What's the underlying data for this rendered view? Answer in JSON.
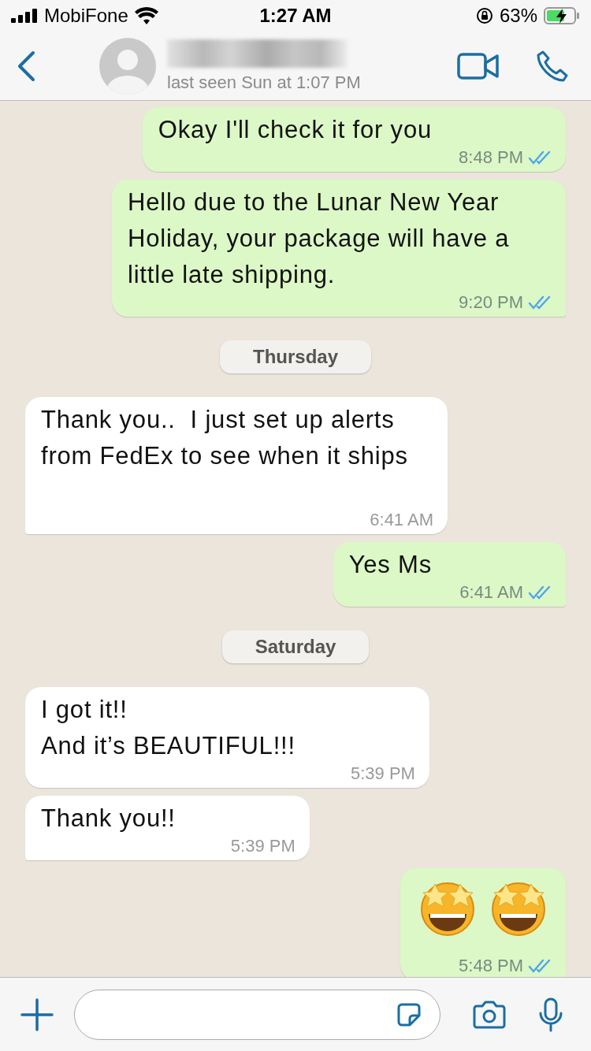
{
  "status_bar": {
    "carrier": "MobiFone",
    "time": "1:27 AM",
    "battery": "63%"
  },
  "header": {
    "last_seen": "last seen Sun at 1:07 PM"
  },
  "messages": [
    {
      "kind": "outgoing",
      "text": "Okay I'll check it for you",
      "time": "8:48 PM",
      "read": true,
      "tail": false
    },
    {
      "kind": "outgoing",
      "text": "Hello due to the Lunar New Year Holiday, your package will have a little late shipping.",
      "time": "9:20 PM",
      "read": true,
      "tail": true
    },
    {
      "kind": "date",
      "text": "Thursday"
    },
    {
      "kind": "incoming",
      "text": "Thank you..  I just set up alerts from FedEx to see when it ships",
      "time": "6:41 AM",
      "tail": true
    },
    {
      "kind": "outgoing",
      "text": "Yes Ms",
      "time": "6:41 AM",
      "read": true,
      "tail": true
    },
    {
      "kind": "date",
      "text": "Saturday"
    },
    {
      "kind": "incoming",
      "text": "I got it!!\nAnd it’s BEAUTIFUL!!!",
      "time": "5:39 PM",
      "tail": false
    },
    {
      "kind": "incoming",
      "text": "Thank you!!",
      "time": "5:39 PM",
      "tail": true
    },
    {
      "kind": "outgoing",
      "emoji": [
        {
          "kind": "star-struck"
        },
        {
          "kind": "star-struck"
        }
      ],
      "time": "5:48 PM",
      "read": true,
      "tail": true
    }
  ]
}
